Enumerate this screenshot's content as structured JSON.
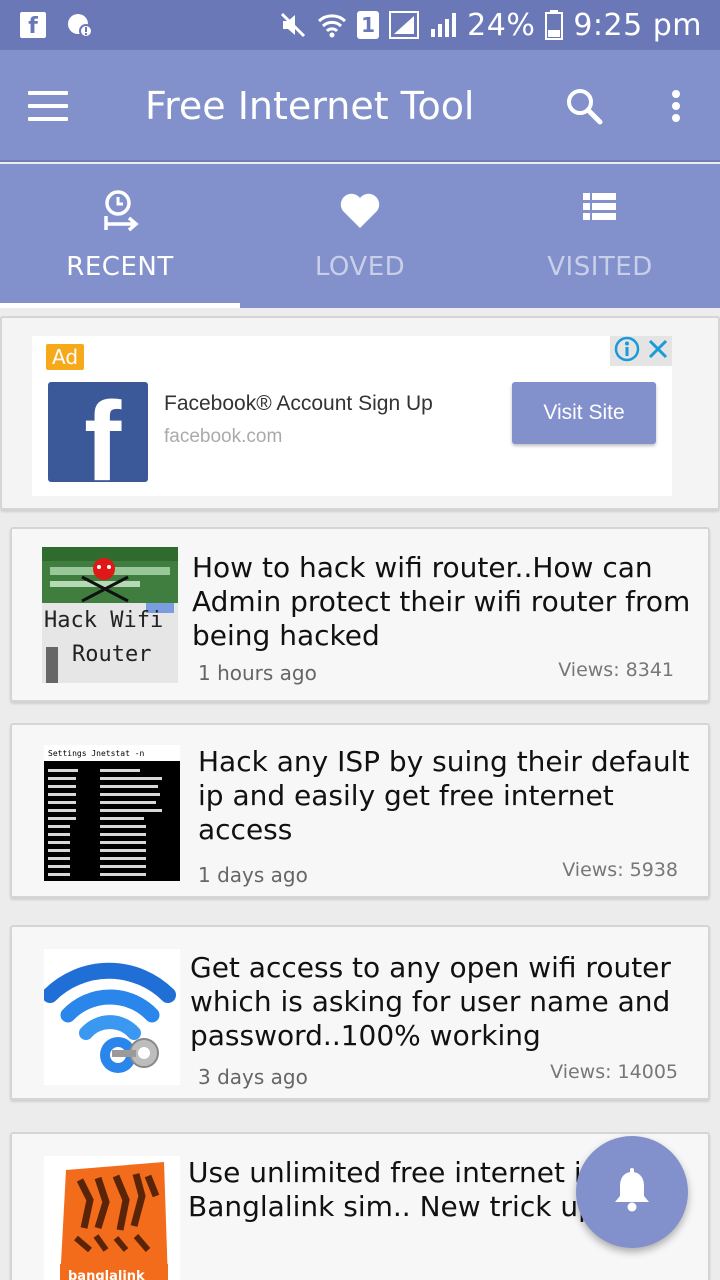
{
  "status_bar": {
    "battery_text": "24%",
    "time": "9:25 pm",
    "sim_slot": "1"
  },
  "app_bar": {
    "title": "Free Internet Tool"
  },
  "tabs": [
    {
      "label": "RECENT",
      "icon": "clock-arrow-icon",
      "active": true
    },
    {
      "label": "LOVED",
      "icon": "heart-icon",
      "active": false
    },
    {
      "label": "VISITED",
      "icon": "list-icon",
      "active": false
    }
  ],
  "ad": {
    "badge": "Ad",
    "title": "Facebook® Account Sign Up",
    "domain": "facebook.com",
    "cta": "Visit Site",
    "logo_letter": "f"
  },
  "posts": [
    {
      "title_lines": [
        "How to hack wifi router..How can",
        "Admin protect their wifi router from",
        "being hacked"
      ],
      "time": "1 hours ago",
      "views": "Views: 8341",
      "thumb_text": [
        "Hack Wifi",
        "Router"
      ]
    },
    {
      "title_lines": [
        "Hack any ISP by suing their default",
        "ip and easily get free internet access"
      ],
      "time": "1 days ago",
      "views": "Views: 5938",
      "thumb_text": [
        "Settings Jnetstat -n"
      ]
    },
    {
      "title_lines": [
        "Get access to any open wifi router",
        "which is asking for user name and",
        "password..100% working"
      ],
      "time": "3 days ago",
      "views": "Views: 14005"
    },
    {
      "title_lines": [
        "Use unlimited free internet ir",
        "Banglalink sim.. New trick up"
      ],
      "thumb_text": [
        "banglalink"
      ]
    }
  ],
  "colors": {
    "primary": "#8291cc",
    "status_bar": "#6a78b8",
    "ad_badge": "#f7a91c",
    "facebook_blue": "#3b5998"
  }
}
